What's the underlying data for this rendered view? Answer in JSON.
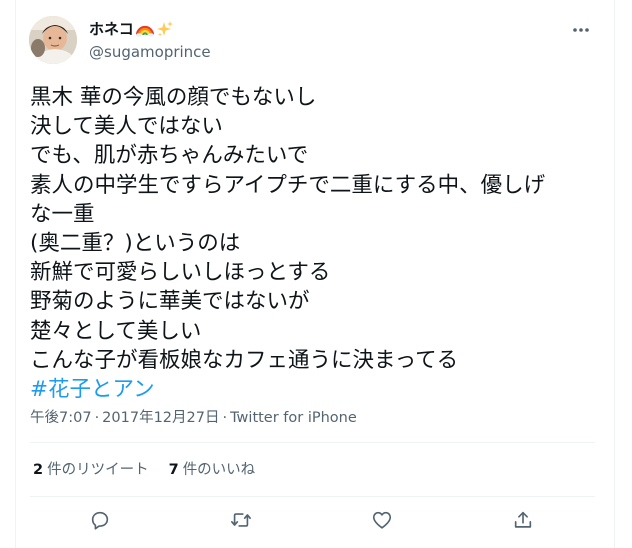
{
  "user": {
    "display_name": "ホネコ",
    "name_emojis": [
      "rainbow-emoji",
      "sparkles-emoji"
    ],
    "handle": "@sugamoprince"
  },
  "tweet": {
    "lines": [
      "黒木 華の今風の顔でもないし",
      "決して美人ではない",
      "でも、肌が赤ちゃんみたいで",
      "素人の中学生ですらアイプチで二重にする中、優しげ",
      "な一重",
      "(奥二重？)というのは",
      "新鮮で可愛らしいしほっとする",
      "野菊のように華美ではないが",
      "楚々として美しい",
      "こんな子が看板娘なカフェ通うに決まってる"
    ],
    "hashtag": "#花子とアン"
  },
  "meta": {
    "time": "午後7:07",
    "separator": "·",
    "date": "2017年12月27日",
    "source": "Twitter for iPhone"
  },
  "stats": {
    "retweets_count": "2",
    "retweets_label": "件のリツイート",
    "likes_count": "7",
    "likes_label": "件のいいね"
  },
  "actions": [
    "reply-icon",
    "retweet-icon",
    "like-icon",
    "share-icon"
  ],
  "colors": {
    "text": "#0f1419",
    "secondary": "#536471",
    "link": "#1d9bf0",
    "divider": "#eff3f4"
  }
}
